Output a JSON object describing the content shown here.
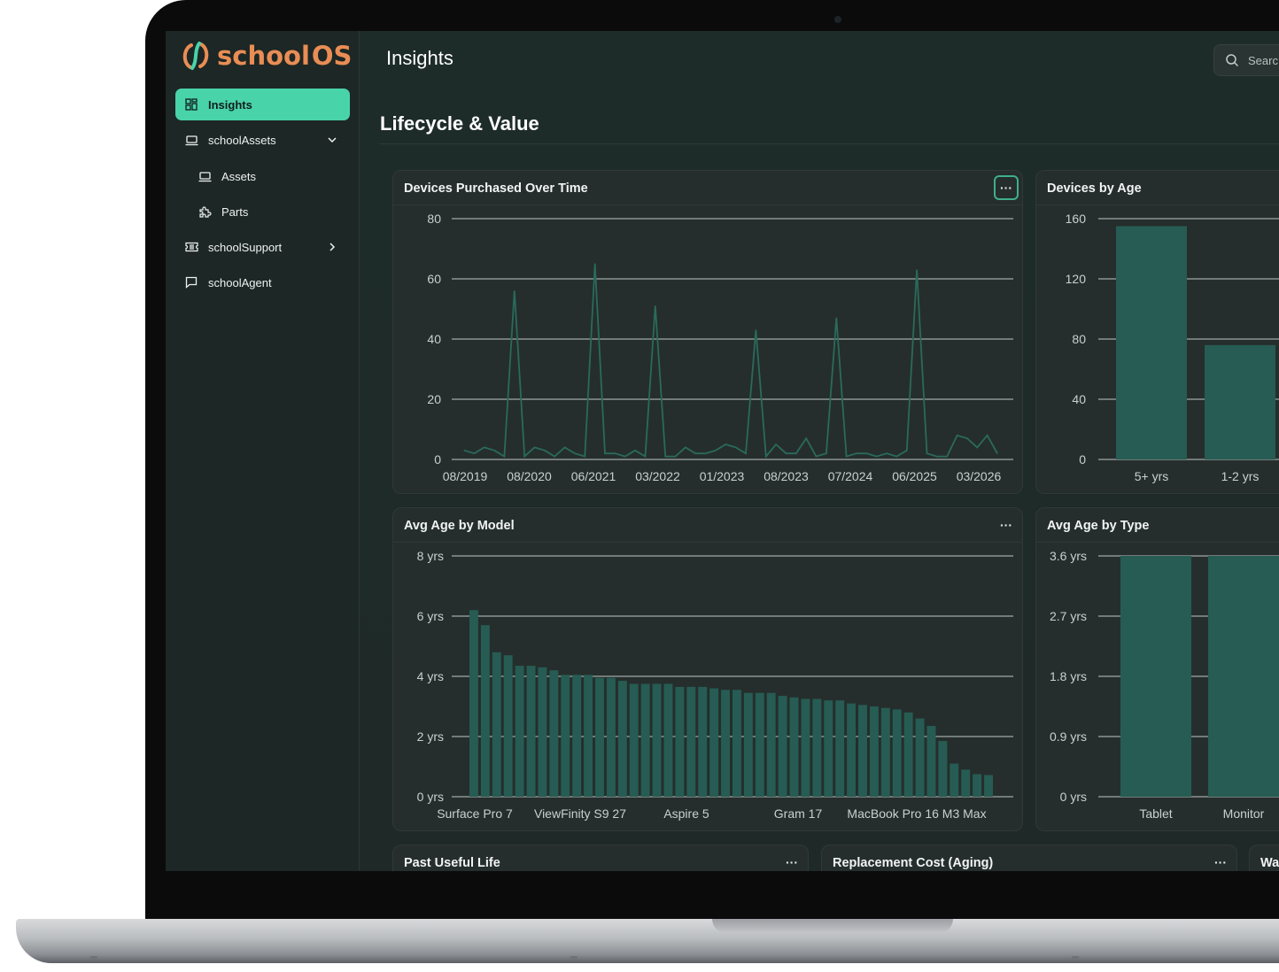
{
  "app": {
    "brand_a": "school",
    "brand_b": "OS",
    "brand_color": "#e98d55",
    "accent_color": "#49d3a9"
  },
  "sidebar": {
    "items": [
      {
        "label": "Insights",
        "icon": "dashboard-grid-icon",
        "active": true
      },
      {
        "label": "schoolAssets",
        "icon": "laptop-icon",
        "chevron": "chevron-down-icon"
      },
      {
        "label": "Assets",
        "icon": "laptop-icon",
        "sub": true
      },
      {
        "label": "Parts",
        "icon": "puzzle-icon",
        "sub": true
      },
      {
        "label": "schoolSupport",
        "icon": "ticket-icon",
        "chevron": "chevron-right-icon"
      },
      {
        "label": "schoolAgent",
        "icon": "chat-icon"
      }
    ]
  },
  "header": {
    "title": "Insights",
    "search_placeholder": "Searc"
  },
  "section": {
    "title": "Lifecycle & Value"
  },
  "cards": {
    "c1": "Devices Purchased Over Time",
    "c2": "Devices by Age",
    "c3": "Avg Age by Model",
    "c4": "Avg Age by Type",
    "c5": "Past Useful Life",
    "c6": "Replacement Cost (Aging)",
    "c7": "Wa",
    "more": "···"
  },
  "chart_data": [
    {
      "type": "line",
      "title": "Devices Purchased Over Time",
      "ylim": [
        0,
        80
      ],
      "yticks": [
        0,
        20,
        40,
        60,
        80
      ],
      "xtick_labels": [
        "08/2019",
        "08/2020",
        "06/2021",
        "03/2022",
        "01/2023",
        "08/2023",
        "07/2024",
        "06/2025",
        "03/2026"
      ],
      "values": [
        3,
        2,
        4,
        3,
        1,
        56,
        1,
        4,
        3,
        1,
        4,
        2,
        1,
        65,
        2,
        2,
        1,
        3,
        1,
        51,
        1,
        1,
        4,
        2,
        2,
        3,
        5,
        4,
        2,
        43,
        1,
        5,
        2,
        2,
        7,
        1,
        2,
        47,
        1,
        2,
        2,
        1,
        2,
        1,
        3,
        63,
        2,
        1,
        1,
        8,
        7,
        4,
        8,
        2
      ],
      "color": "#2a6a5c"
    },
    {
      "type": "bar",
      "title": "Devices by Age",
      "ylim": [
        0,
        160
      ],
      "yticks": [
        0,
        40,
        80,
        120,
        160
      ],
      "categories": [
        "5+ yrs",
        "1-2 yrs"
      ],
      "values": [
        155,
        76
      ],
      "color": "#265c53"
    },
    {
      "type": "bar",
      "title": "Avg Age by Model",
      "ylim": [
        0,
        8
      ],
      "ytick_labels": [
        "0 yrs",
        "2 yrs",
        "4 yrs",
        "6 yrs",
        "8 yrs"
      ],
      "yticks": [
        0,
        2,
        4,
        6,
        8
      ],
      "xtick_labels": [
        "Surface Pro 7",
        "ViewFinity S9 27",
        "Aspire 5",
        "Gram 17",
        "MacBook Pro 16 M3 Max"
      ],
      "values": [
        6.2,
        5.7,
        4.8,
        4.7,
        4.35,
        4.35,
        4.3,
        4.2,
        4.05,
        4.05,
        4.05,
        3.95,
        3.95,
        3.85,
        3.75,
        3.75,
        3.75,
        3.75,
        3.65,
        3.65,
        3.65,
        3.6,
        3.55,
        3.55,
        3.45,
        3.45,
        3.45,
        3.35,
        3.3,
        3.25,
        3.25,
        3.2,
        3.2,
        3.1,
        3.05,
        3.0,
        2.95,
        2.9,
        2.8,
        2.6,
        2.35,
        1.85,
        1.1,
        0.9,
        0.75,
        0.72
      ],
      "color": "#265c53"
    },
    {
      "type": "bar",
      "title": "Avg Age by Type",
      "ylim": [
        0,
        3.6
      ],
      "ytick_labels": [
        "0 yrs",
        "0.9 yrs",
        "1.8 yrs",
        "2.7 yrs",
        "3.6 yrs"
      ],
      "yticks": [
        0,
        0.9,
        1.8,
        2.7,
        3.6
      ],
      "categories": [
        "Tablet",
        "Monitor"
      ],
      "values": [
        3.6,
        3.6
      ],
      "color": "#265c53"
    }
  ]
}
